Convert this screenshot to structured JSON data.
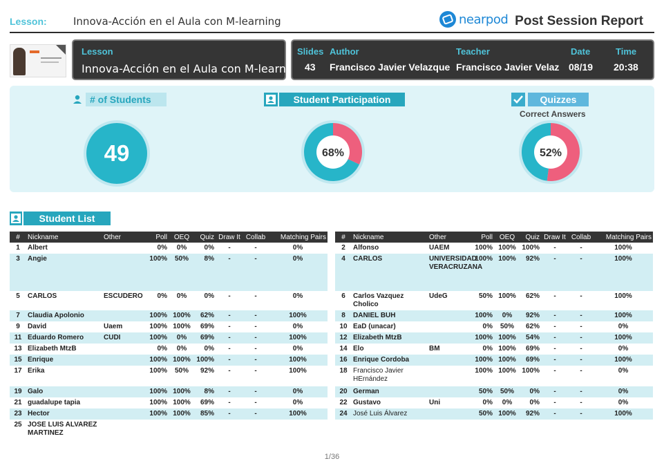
{
  "header": {
    "lesson_label": "Lesson:",
    "lesson_title": "Innova-Acción en el Aula con M-learning",
    "brand": "nearpod",
    "report_title": "Post Session Report"
  },
  "info": {
    "lesson_label": "Lesson",
    "lesson_value": "Innova-Acción en el Aula con M-learnin...",
    "slides_label": "Slides",
    "slides_value": "43",
    "author_label": "Author",
    "author_value": "Francisco Javier Velazque",
    "teacher_label": "Teacher",
    "teacher_value": "Francisco Javier Velaz",
    "date_label": "Date",
    "date_value": "08/19",
    "time_label": "Time",
    "time_value": "20:38"
  },
  "stats": {
    "students_label": "# of Students",
    "students_value": "49",
    "participation_label": "Student Participation",
    "participation_value": "68%",
    "participation_pct": 68,
    "quizzes_label": "Quizzes",
    "quizzes_sub": "Correct Answers",
    "quizzes_value": "52%",
    "quizzes_pct": 52
  },
  "colors": {
    "teal": "#27b5c9",
    "pink": "#ee5f7d",
    "ring": "#bfe7ef"
  },
  "student_list": {
    "title": "Student List",
    "columns": [
      "#",
      "Nickname",
      "Other",
      "Poll",
      "OEQ",
      "Quiz",
      "Draw It",
      "Collab",
      "Matching Pairs"
    ],
    "left": [
      {
        "n": "1",
        "name": "Albert",
        "other": "",
        "poll": "0%",
        "oeq": "0%",
        "quiz": "0%",
        "draw": "-",
        "collab": "-",
        "mp": "0%"
      },
      {
        "n": "3",
        "name": "Angie",
        "other": "",
        "poll": "100%",
        "oeq": "50%",
        "quiz": "8%",
        "draw": "-",
        "collab": "-",
        "mp": "0%",
        "h": 54
      },
      {
        "n": "5",
        "name": "CARLOS",
        "other": "ESCUDERO",
        "poll": "0%",
        "oeq": "0%",
        "quiz": "0%",
        "draw": "-",
        "collab": "-",
        "mp": "0%",
        "h": 28
      },
      {
        "n": "7",
        "name": "Claudia Apolonio",
        "other": "",
        "poll": "100%",
        "oeq": "100%",
        "quiz": "62%",
        "draw": "-",
        "collab": "-",
        "mp": "100%"
      },
      {
        "n": "9",
        "name": "David",
        "other": "Uaem",
        "poll": "100%",
        "oeq": "100%",
        "quiz": "69%",
        "draw": "-",
        "collab": "-",
        "mp": "0%"
      },
      {
        "n": "11",
        "name": "Eduardo Romero",
        "other": "CUDI",
        "poll": "100%",
        "oeq": "0%",
        "quiz": "69%",
        "draw": "-",
        "collab": "-",
        "mp": "100%"
      },
      {
        "n": "13",
        "name": "Elizabeth MtzB",
        "other": "",
        "poll": "0%",
        "oeq": "0%",
        "quiz": "0%",
        "draw": "-",
        "collab": "-",
        "mp": "0%"
      },
      {
        "n": "15",
        "name": "Enrique",
        "other": "",
        "poll": "100%",
        "oeq": "100%",
        "quiz": "100%",
        "draw": "-",
        "collab": "-",
        "mp": "100%"
      },
      {
        "n": "17",
        "name": "Erika",
        "other": "",
        "poll": "100%",
        "oeq": "50%",
        "quiz": "92%",
        "draw": "-",
        "collab": "-",
        "mp": "100%",
        "h": 30
      },
      {
        "n": "19",
        "name": "Galo",
        "other": "",
        "poll": "100%",
        "oeq": "100%",
        "quiz": "8%",
        "draw": "-",
        "collab": "-",
        "mp": "0%"
      },
      {
        "n": "21",
        "name": "guadalupe tapia",
        "other": "",
        "poll": "100%",
        "oeq": "100%",
        "quiz": "69%",
        "draw": "-",
        "collab": "-",
        "mp": "0%"
      },
      {
        "n": "23",
        "name": "Hector",
        "other": "",
        "poll": "100%",
        "oeq": "100%",
        "quiz": "85%",
        "draw": "-",
        "collab": "-",
        "mp": "100%"
      },
      {
        "n": "25",
        "name": "JOSE LUIS ALVAREZ MARTINEZ",
        "other": "",
        "poll": "",
        "oeq": "",
        "quiz": "",
        "draw": "",
        "collab": "",
        "mp": "",
        "h": 28
      }
    ],
    "right": [
      {
        "n": "2",
        "name": "Alfonso",
        "other": "UAEM",
        "poll": "100%",
        "oeq": "100%",
        "quiz": "100%",
        "draw": "-",
        "collab": "-",
        "mp": "100%"
      },
      {
        "n": "4",
        "name": "CARLOS",
        "other": "UNIVERSIDAD VERACRUZANA",
        "poll": "100%",
        "oeq": "100%",
        "quiz": "92%",
        "draw": "-",
        "collab": "-",
        "mp": "100%",
        "h": 54
      },
      {
        "n": "6",
        "name": "Carlos Vazquez Cholico",
        "other": "UdeG",
        "poll": "50%",
        "oeq": "100%",
        "quiz": "62%",
        "draw": "-",
        "collab": "-",
        "mp": "100%",
        "h": 28
      },
      {
        "n": "8",
        "name": "DANIEL BUH",
        "other": "",
        "poll": "100%",
        "oeq": "0%",
        "quiz": "92%",
        "draw": "-",
        "collab": "-",
        "mp": "100%"
      },
      {
        "n": "10",
        "name": "EaD (unacar)",
        "other": "",
        "poll": "0%",
        "oeq": "50%",
        "quiz": "62%",
        "draw": "-",
        "collab": "-",
        "mp": "0%"
      },
      {
        "n": "12",
        "name": "Elizabeth MtzB",
        "other": "",
        "poll": "100%",
        "oeq": "100%",
        "quiz": "54%",
        "draw": "-",
        "collab": "-",
        "mp": "100%"
      },
      {
        "n": "14",
        "name": "Elo",
        "other": "BM",
        "poll": "0%",
        "oeq": "100%",
        "quiz": "69%",
        "draw": "-",
        "collab": "-",
        "mp": "0%"
      },
      {
        "n": "16",
        "name": "Enrique Cordoba",
        "other": "",
        "poll": "100%",
        "oeq": "100%",
        "quiz": "69%",
        "draw": "-",
        "collab": "-",
        "mp": "100%"
      },
      {
        "n": "18",
        "name": "Francisco Javier HErnández",
        "other": "",
        "poll": "100%",
        "oeq": "100%",
        "quiz": "100%",
        "draw": "-",
        "collab": "-",
        "mp": "0%",
        "h": 30,
        "lite": true
      },
      {
        "n": "20",
        "name": "German",
        "other": "",
        "poll": "50%",
        "oeq": "50%",
        "quiz": "0%",
        "draw": "-",
        "collab": "-",
        "mp": "0%"
      },
      {
        "n": "22",
        "name": "Gustavo",
        "other": "Uni",
        "poll": "0%",
        "oeq": "0%",
        "quiz": "0%",
        "draw": "-",
        "collab": "-",
        "mp": "0%"
      },
      {
        "n": "24",
        "name": "José Luis Álvarez",
        "other": "",
        "poll": "50%",
        "oeq": "100%",
        "quiz": "92%",
        "draw": "-",
        "collab": "-",
        "mp": "100%",
        "lite": true
      }
    ]
  },
  "footer": {
    "page": "1/36"
  }
}
